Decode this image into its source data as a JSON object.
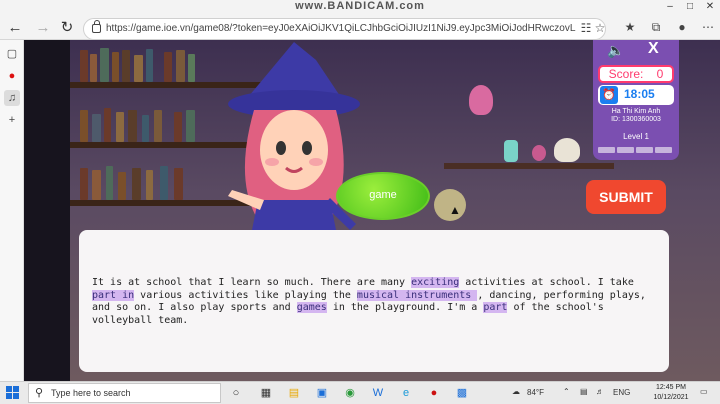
{
  "watermark": "www.BANDICAM.com",
  "browser": {
    "url": "https://game.ioe.vn/game08/?token=eyJ0eXAiOiJKV1QiLCJhbGciOiJIUzI1NiJ9.eyJpc3MiOiJodHRwczovL2Vkd55nby52bilsInN1YiI6ImdhbWU"
  },
  "game": {
    "bubble_word": "game",
    "scoreboard": {
      "score_label": "Score:",
      "score_value": "0",
      "timer": "18:05",
      "player_name": "Ha Thi Kim Anh",
      "player_id": "ID: 1300360003",
      "level": "Level 1"
    },
    "submit_label": "SUBMIT",
    "passage": [
      {
        "text": "It is at school that I learn so much. There are many ",
        "hl": false
      },
      {
        "text": "exciting",
        "hl": true
      },
      {
        "text": " activities at school. I take ",
        "hl": false
      },
      {
        "text": "part in",
        "hl": true
      },
      {
        "text": " various activities like playing the ",
        "hl": false
      },
      {
        "text": "musical instruments ",
        "hl": true
      },
      {
        "text": ", dancing, performing plays, and so on. I also play sports and ",
        "hl": false
      },
      {
        "text": "games",
        "hl": true
      },
      {
        "text": " in the playground. I'm a ",
        "hl": false
      },
      {
        "text": "part",
        "hl": true
      },
      {
        "text": " of the school's volleyball team.",
        "hl": false
      }
    ]
  },
  "taskbar": {
    "search_placeholder": "Type here to search",
    "weather": "84°F",
    "language": "ENG",
    "time": "12:45 PM",
    "date": "10/12/2021"
  }
}
